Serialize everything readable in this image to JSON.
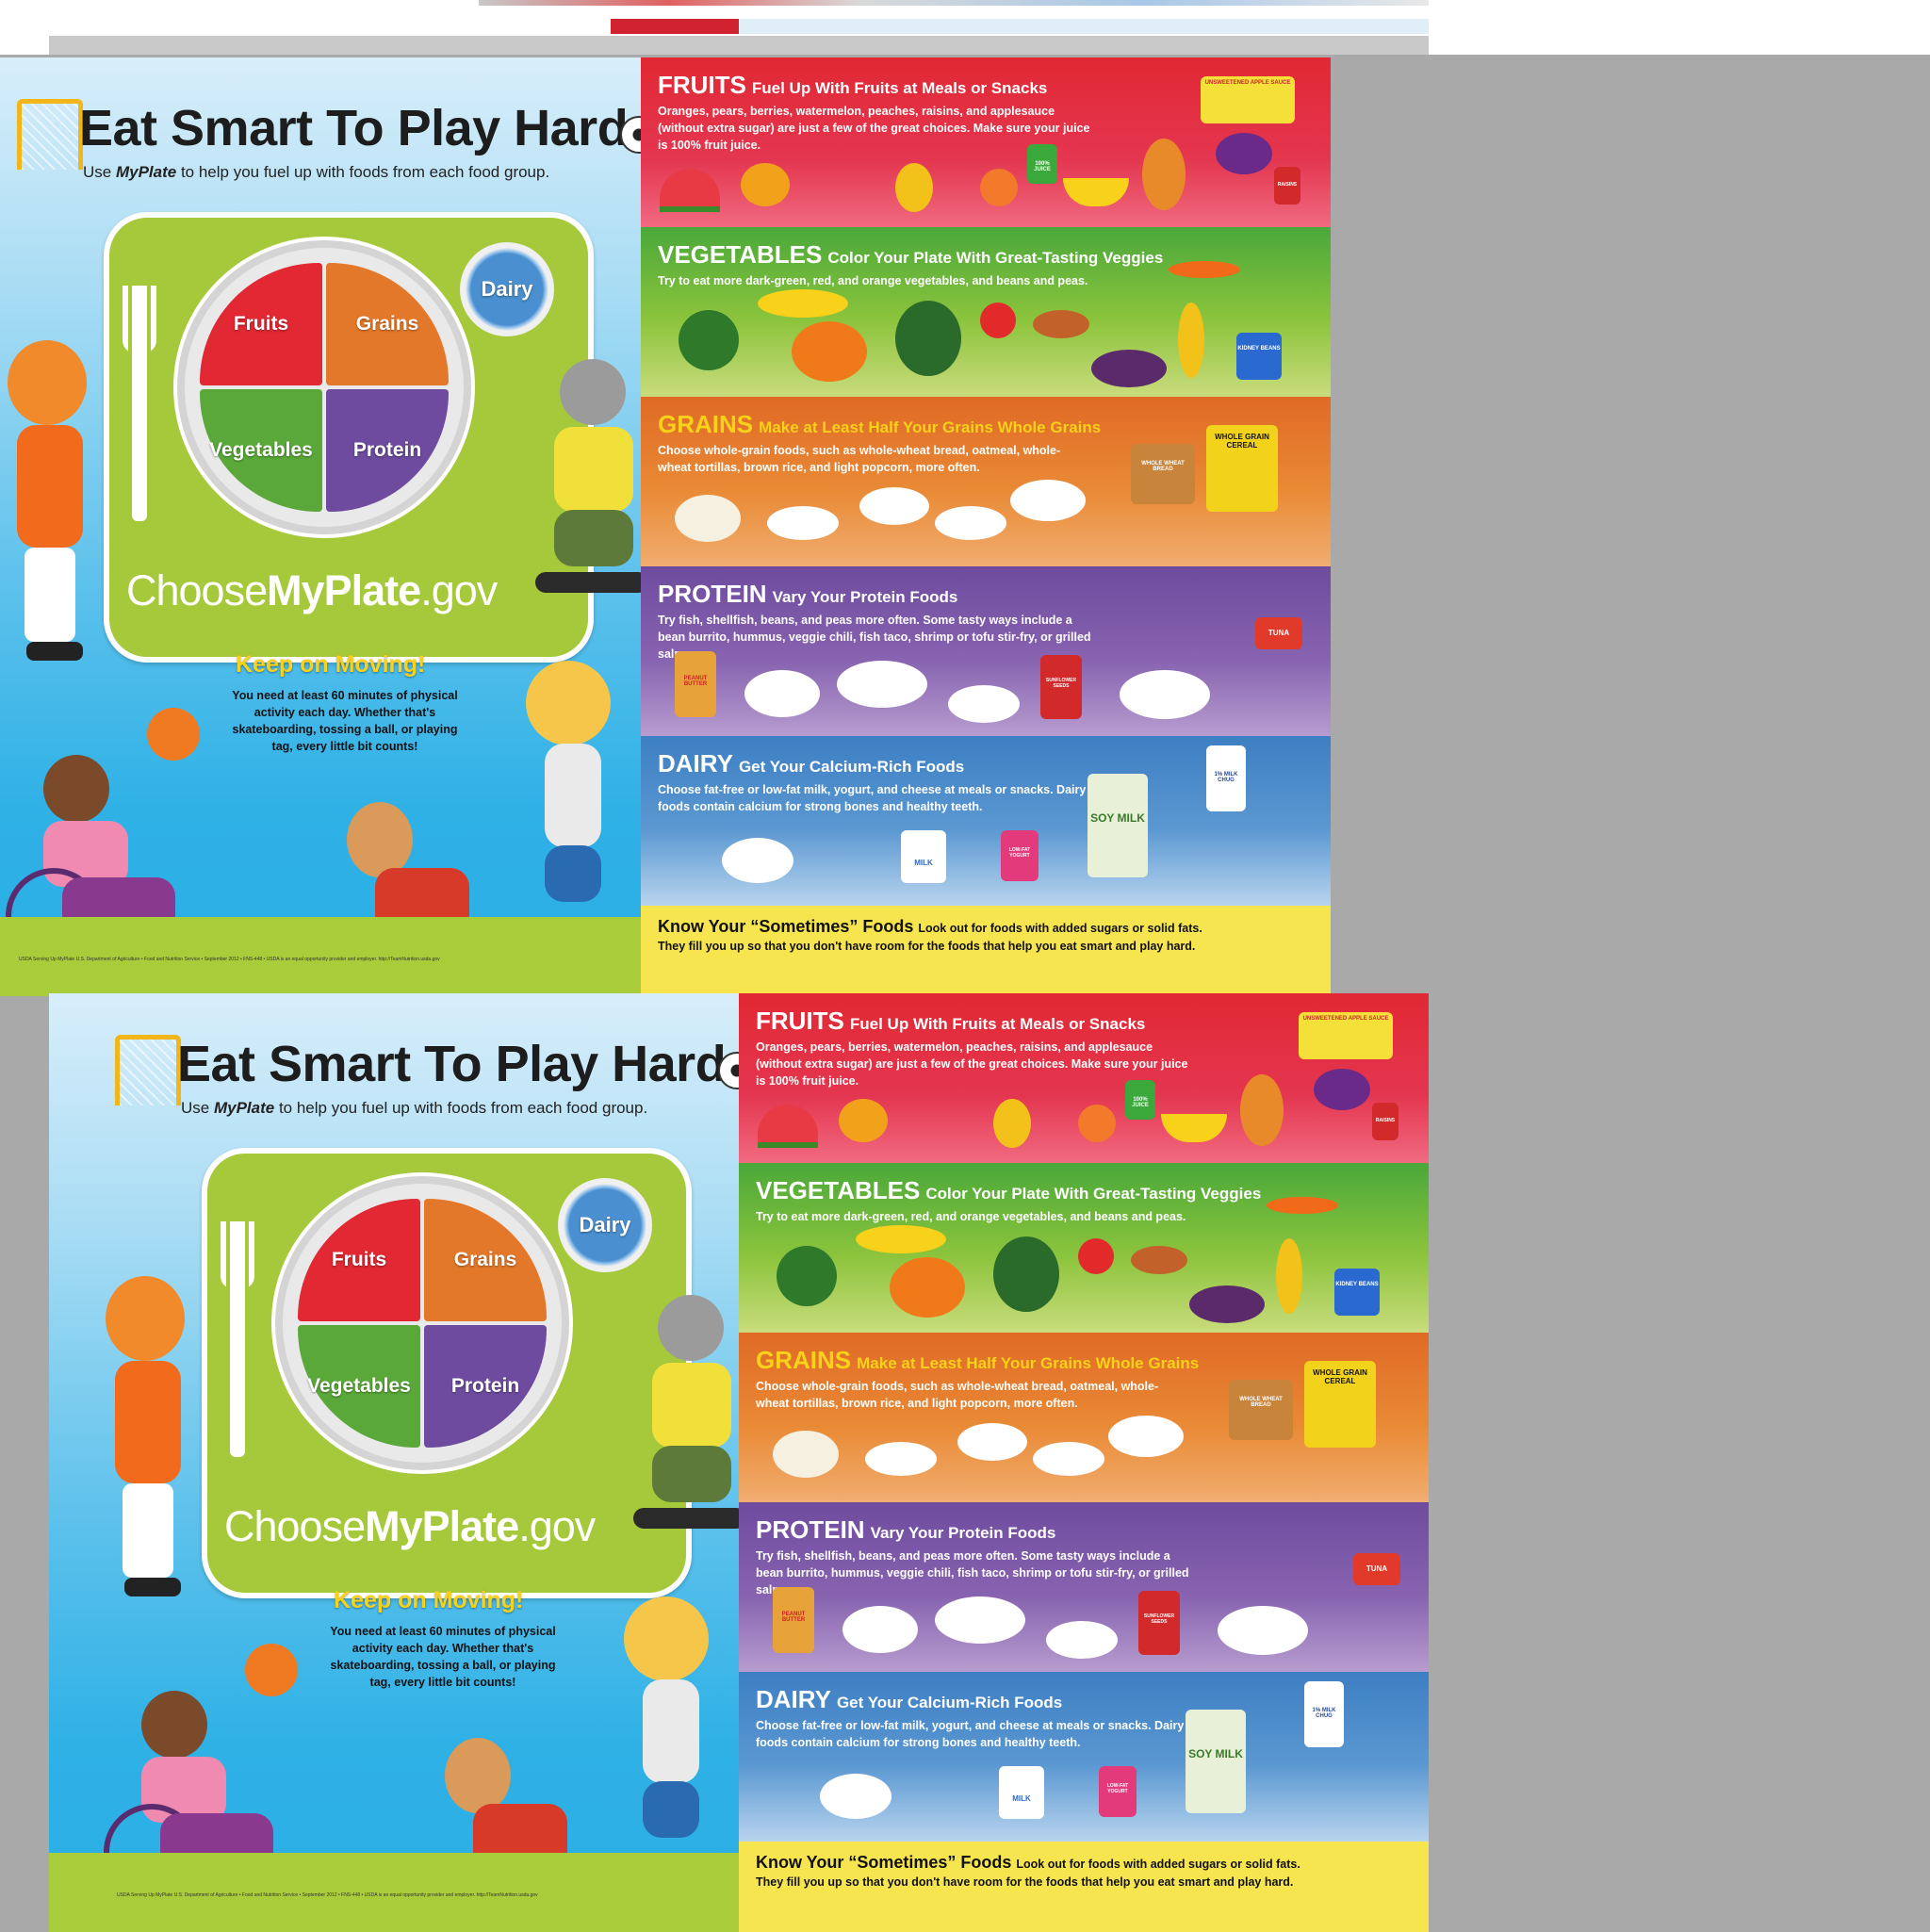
{
  "title": "Eat Smart To Play Hard",
  "subtitle_pre": "Use ",
  "subtitle_brand": "MyPlate",
  "subtitle_post": " to help you fuel up with foods from each food group.",
  "plate": {
    "fruits": "Fruits",
    "grains": "Grains",
    "vegetables": "Vegetables",
    "protein": "Protein",
    "dairy": "Dairy"
  },
  "site": {
    "pre": "Choose",
    "brand": "MyPlate",
    "post": ".gov"
  },
  "keep": {
    "title": "Keep on Moving!",
    "text": "You need at least 60 minutes of physical activity each day. Whether that's skateboarding, tossing a ball, or playing tag, every little bit counts!"
  },
  "footer_small": "USDA  Serving Up MyPlate  U.S. Department of Agriculture • Food and Nutrition Service • September 2012 • FNS-448 • USDA is an equal opportunity provider and employer.   http://TeamNutrition.usda.gov",
  "bands": {
    "fruits": {
      "name": "FRUITS",
      "slogan": "Fuel Up With Fruits at Meals or Snacks",
      "text": "Oranges, pears, berries, watermelon, peaches, raisins, and applesauce (without extra sugar) are just a few of the great choices. Make sure your juice is 100% fruit juice."
    },
    "vegetables": {
      "name": "VEGETABLES",
      "slogan": "Color Your Plate With Great-Tasting Veggies",
      "text": "Try to eat more dark-green, red, and orange vegetables, and beans and peas."
    },
    "grains": {
      "name": "GRAINS",
      "slogan": "Make at Least Half Your Grains Whole Grains",
      "text": "Choose whole-grain foods, such as whole-wheat bread, oatmeal, whole-wheat tortillas, brown rice, and light popcorn, more often."
    },
    "protein": {
      "name": "PROTEIN",
      "slogan": "Vary Your Protein Foods",
      "text": "Try fish, shellfish, beans, and peas more often. Some tasty ways include a bean burrito, hummus, veggie chili, fish taco, shrimp or tofu stir-fry, or grilled salmon."
    },
    "dairy": {
      "name": "DAIRY",
      "slogan": "Get Your Calcium-Rich Foods",
      "text": "Choose fat-free or low-fat milk, yogurt, and cheese at meals or snacks. Dairy foods contain calcium for strong bones and healthy teeth."
    },
    "sometimes": {
      "name": "Know Your “Sometimes” Foods",
      "slogan": "Look out for foods with added sugars or solid fats.",
      "text": "They fill you up so that you don't have room for the foods that help you eat smart and play hard."
    }
  },
  "package_labels": {
    "juice": "100% JUICE",
    "raisins": "RAISINS",
    "applesauce": "UNSWEETENED APPLE SAUCE",
    "beans": "KIDNEY BEANS",
    "bread": "WHOLE WHEAT BREAD",
    "cereal": "WHOLE GRAIN CEREAL",
    "pb": "PEANUT BUTTER",
    "seeds": "SUNFLOWER SEEDS",
    "tuna": "TUNA",
    "soy": "SOY MILK",
    "milk": "MILK",
    "fatfree": "FAT FREE",
    "yogurt": "LOW-FAT YOGURT",
    "chug": "1% MILK CHUG"
  },
  "colors": {
    "fruits": "#e12833",
    "vegetables": "#5ba83a",
    "grains": "#e3782a",
    "protein": "#6e4b9e",
    "dairy": "#4a8fd0",
    "sometimes": "#f7e550",
    "mat": "#a5c93a"
  }
}
